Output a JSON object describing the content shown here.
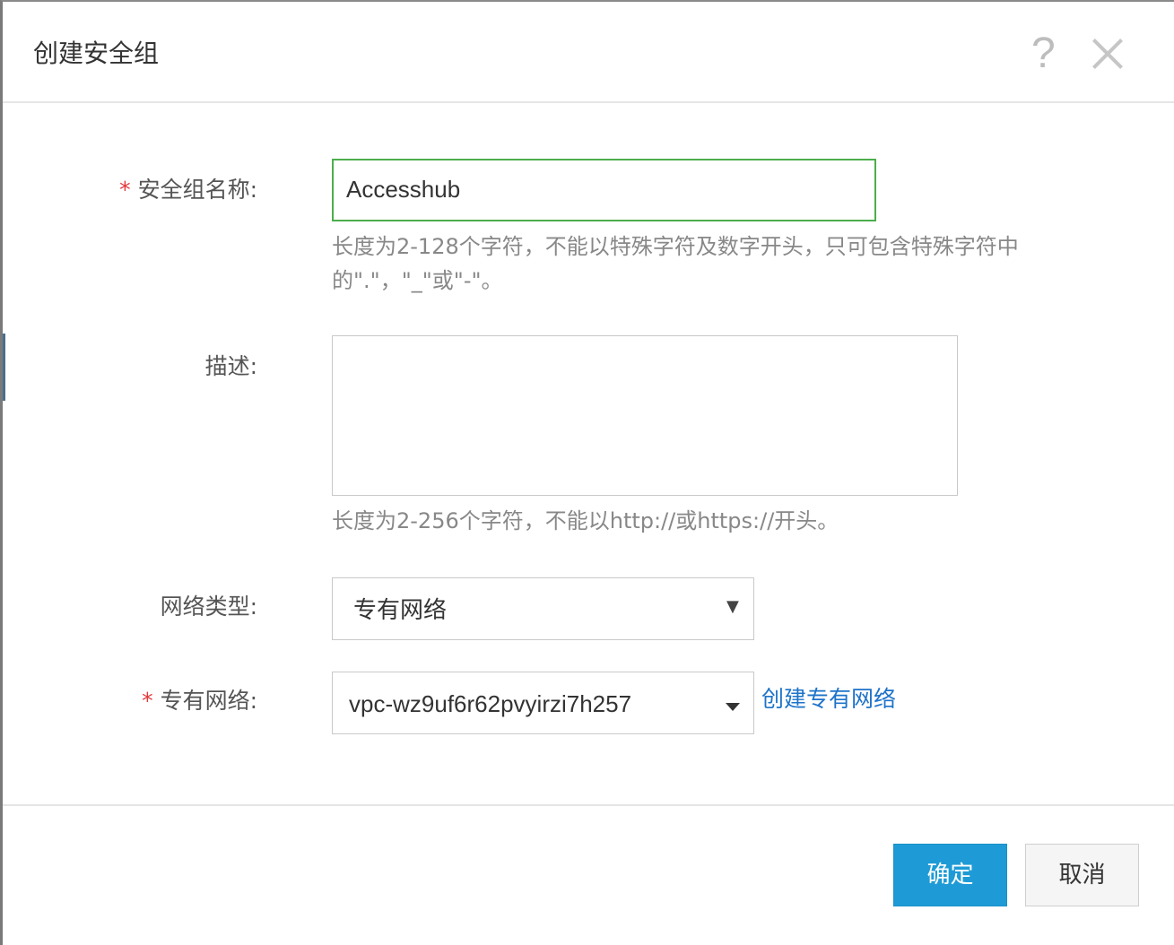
{
  "dialog": {
    "title": "创建安全组",
    "help_icon": "?",
    "close_icon": "close-icon"
  },
  "form": {
    "name": {
      "required_mark": "*",
      "label": "安全组名称:",
      "value": "Accesshub",
      "hint_line1": "长度为2-128个字符，不能以特殊字符及数字开头，只可包含特殊字符中",
      "hint_line2": "的\".\"，\"_\"或\"-\"。"
    },
    "description": {
      "label": "描述:",
      "value": "",
      "hint": "长度为2-256个字符，不能以http://或https://开头。"
    },
    "network_type": {
      "label": "网络类型:",
      "selected": "专有网络",
      "arrow": "▼"
    },
    "vpc": {
      "required_mark": "*",
      "label": "专有网络:",
      "selected": "vpc-wz9uf6r62pvyirzi7h257",
      "create_link": "创建专有网络"
    }
  },
  "footer": {
    "confirm_label": "确定",
    "cancel_label": "取消"
  },
  "colors": {
    "primary": "#1e9bd6",
    "link": "#1d73c9",
    "required": "#e4393c",
    "focus_border": "#4cae4c"
  }
}
